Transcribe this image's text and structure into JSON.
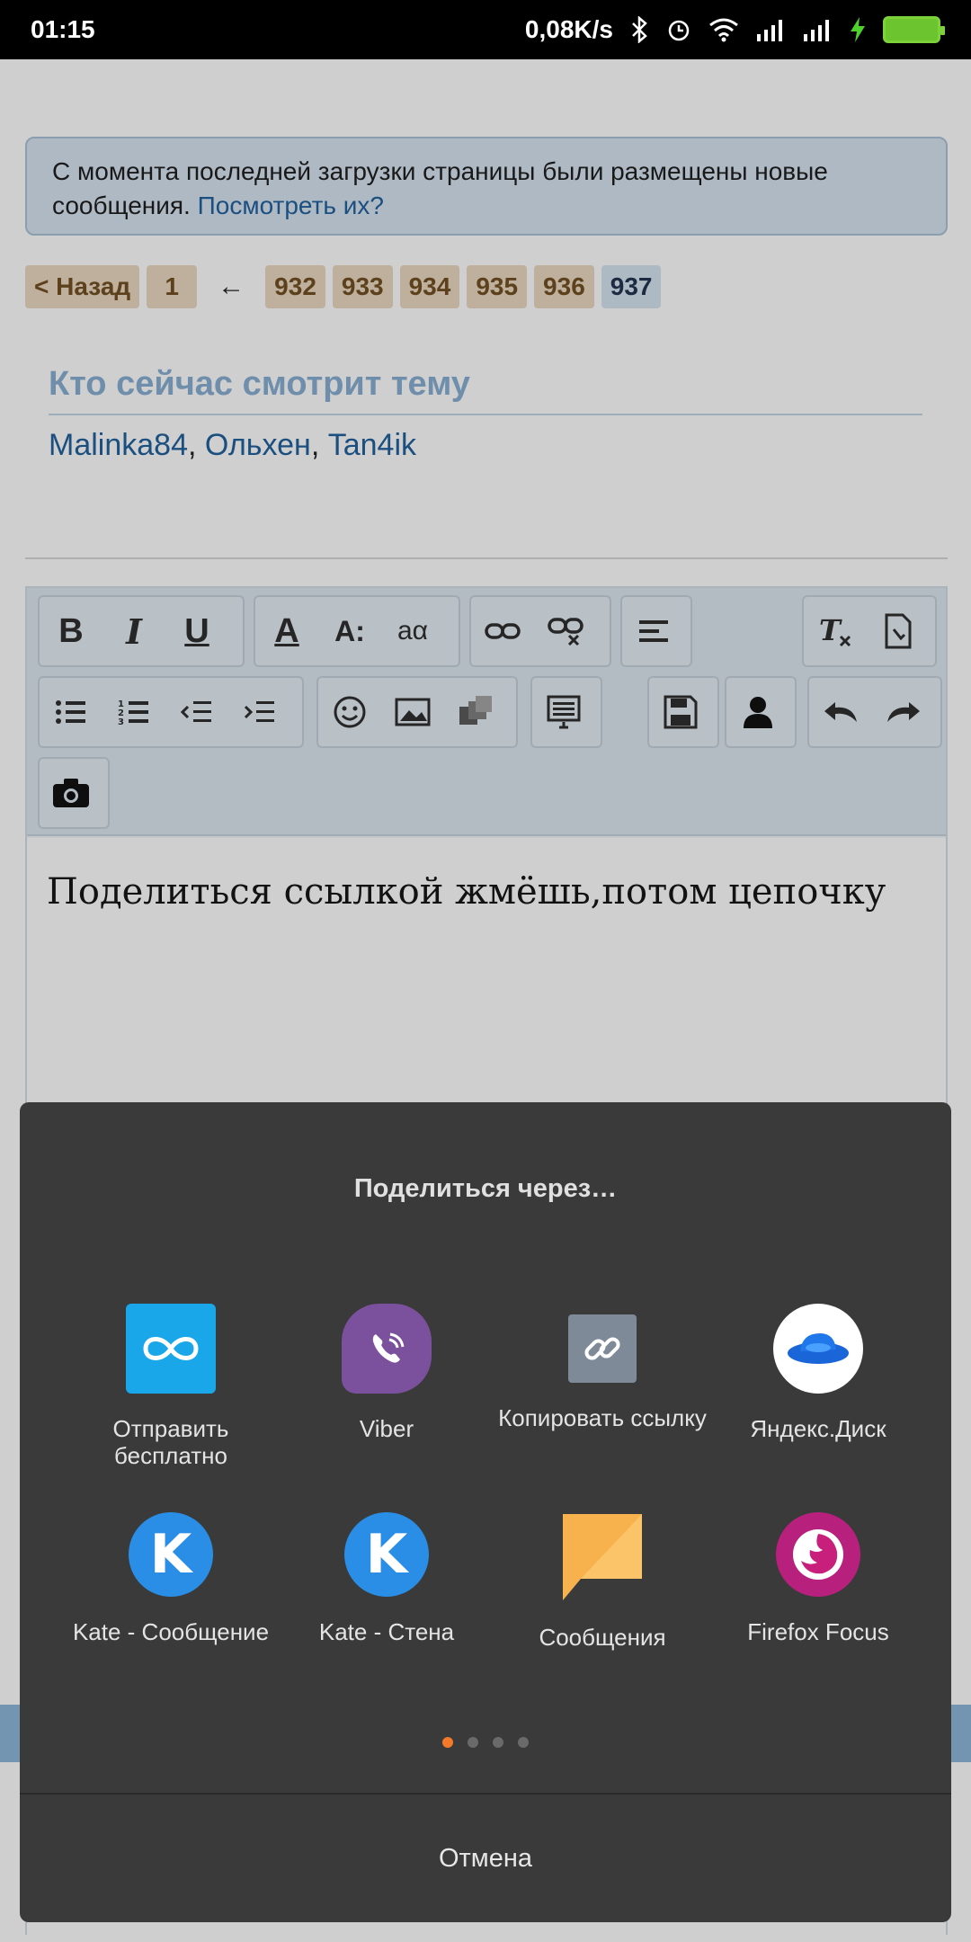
{
  "status_bar": {
    "time": "01:15",
    "speed": "0,08K/s",
    "icons": [
      "bluetooth-icon",
      "alarm-icon",
      "wifi-icon",
      "signal-icon",
      "signal-icon",
      "charging-icon",
      "battery-icon"
    ]
  },
  "notice": {
    "text": "С момента последней загрузки страницы были размещены новые сообщения. ",
    "link": "Посмотреть их?"
  },
  "pager": {
    "back": "< Назад",
    "first": "1",
    "arrow": "←",
    "pages": [
      "932",
      "933",
      "934",
      "935",
      "936"
    ],
    "current": "937"
  },
  "whois": {
    "title": "Кто сейчас смотрит тему",
    "users": [
      "Malinka84",
      "Ольхен",
      "Tan4ik"
    ],
    "separator": ", "
  },
  "editor": {
    "text": "Поделиться ссылкой жмёшь,потом цепочку",
    "toolbar_icons": {
      "bold": "B",
      "italic": "I",
      "underline": "U",
      "font_color": "A",
      "font_size": "A:",
      "font_family": "aα"
    }
  },
  "share_sheet": {
    "title": "Поделиться через…",
    "apps": [
      {
        "label": "Отправить бесплатно",
        "icon": "infinity-icon",
        "color": "#19a7ea"
      },
      {
        "label": "Viber",
        "icon": "viber-icon",
        "color": "#7b519d"
      },
      {
        "label": "Копировать ссылку",
        "icon": "link-icon",
        "color": "#7e8a97"
      },
      {
        "label": "Яндекс.Диск",
        "icon": "yandex-disk-icon",
        "color": "#1a66d8"
      },
      {
        "label": "Kate - Сообщение",
        "icon": "kate-icon",
        "color": "#2a8ee6"
      },
      {
        "label": "Kate - Стена",
        "icon": "kate-icon",
        "color": "#2a8ee6"
      },
      {
        "label": "Сообщения",
        "icon": "messages-icon",
        "color": "#f7b24d"
      },
      {
        "label": "Firefox Focus",
        "icon": "firefox-focus-icon",
        "color": "#b8207d"
      }
    ],
    "page_count": 4,
    "active_page": 0,
    "cancel": "Отмена"
  }
}
